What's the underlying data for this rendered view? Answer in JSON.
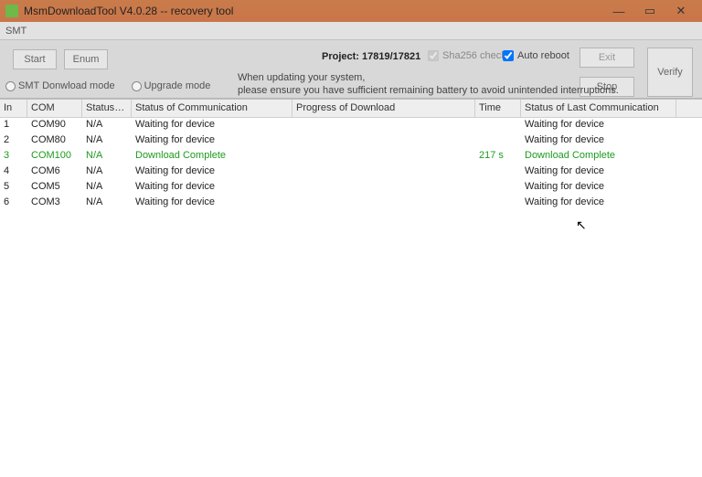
{
  "titlebar": {
    "title": "MsmDownloadTool V4.0.28 -- recovery tool"
  },
  "tab": {
    "label": "SMT"
  },
  "toolbar": {
    "start": "Start",
    "enum": "Enum",
    "project_label": "Project:",
    "project_value": "17819/17821",
    "sha_label": "Sha256 check",
    "sha_checked": true,
    "auto_label": "Auto reboot",
    "auto_checked": true,
    "exit": "Exit",
    "stop": "Stop",
    "verify": "Verify",
    "warning_line1": "When updating your system,",
    "warning_line2": "please ensure you have sufficient remaining battery to avoid unintended interruptions.",
    "mode_download": "SMT Donwload mode",
    "mode_upgrade": "Upgrade mode"
  },
  "columns": {
    "c0": "In",
    "c1": "COM",
    "c2": "Status o...",
    "c3": "Status of Communication",
    "c4": "Progress of Download",
    "c5": "Time",
    "c6": "Status of Last Communication"
  },
  "rows": [
    {
      "in": "1",
      "com": "COM90",
      "stat": "N/A",
      "comm": "Waiting for device",
      "prog": "",
      "time": "",
      "last": "Waiting for device",
      "green": false
    },
    {
      "in": "2",
      "com": "COM80",
      "stat": "N/A",
      "comm": "Waiting for device",
      "prog": "",
      "time": "",
      "last": "Waiting for device",
      "green": false
    },
    {
      "in": "3",
      "com": "COM100",
      "stat": "N/A",
      "comm": "Download Complete",
      "prog": "",
      "time": "217 s",
      "last": "Download Complete",
      "green": true
    },
    {
      "in": "4",
      "com": "COM6",
      "stat": "N/A",
      "comm": "Waiting for device",
      "prog": "",
      "time": "",
      "last": "Waiting for device",
      "green": false
    },
    {
      "in": "5",
      "com": "COM5",
      "stat": "N/A",
      "comm": "Waiting for device",
      "prog": "",
      "time": "",
      "last": "Waiting for device",
      "green": false
    },
    {
      "in": "6",
      "com": "COM3",
      "stat": "N/A",
      "comm": "Waiting for device",
      "prog": "",
      "time": "",
      "last": "Waiting for device",
      "green": false
    }
  ]
}
